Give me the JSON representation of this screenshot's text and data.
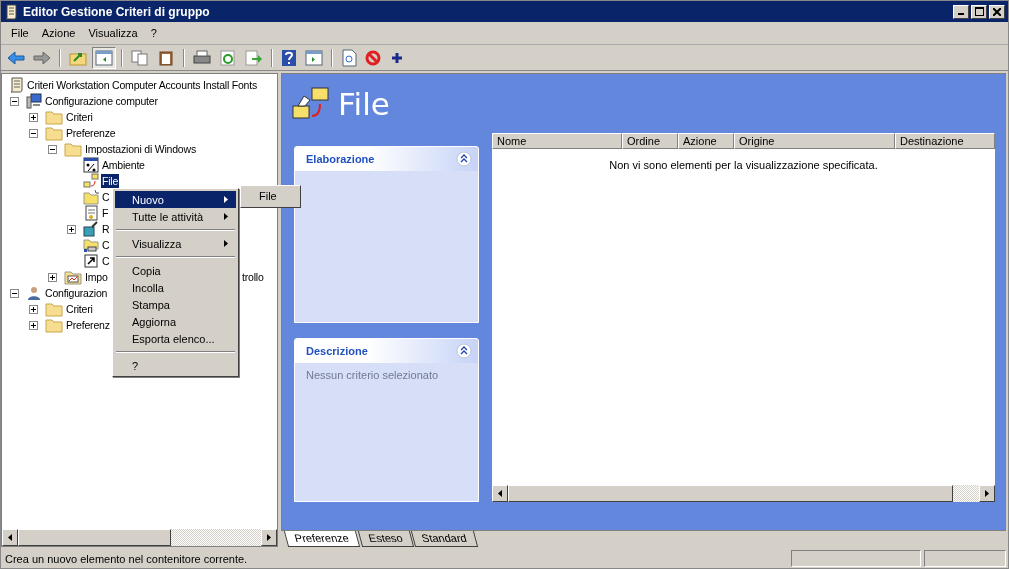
{
  "window": {
    "title": "Editor Gestione Criteri di gruppo"
  },
  "menu_bar": [
    "File",
    "Azione",
    "Visualizza",
    "?"
  ],
  "tree": [
    {
      "label": "Criteri Workstation Computer Accounts Install Fonts",
      "kind": "policy",
      "selected": false,
      "children": [
        {
          "label": "Configurazione computer",
          "kind": "computer",
          "expanded": true,
          "selected": false,
          "children": [
            {
              "label": "Criteri",
              "kind": "folder",
              "expanded": false,
              "selected": false
            },
            {
              "label": "Preferenze",
              "kind": "folder",
              "expanded": true,
              "selected": false,
              "children": [
                {
                  "label": "Impostazioni di Windows",
                  "kind": "folder",
                  "expanded": true,
                  "selected": false,
                  "children": [
                    {
                      "label": "Ambiente",
                      "kind": "env",
                      "selected": false
                    },
                    {
                      "label": "File",
                      "kind": "files",
                      "selected": true
                    },
                    {
                      "label": "C",
                      "kind": "newfolder",
                      "selected": false
                    },
                    {
                      "label": "F",
                      "kind": "ini",
                      "selected": false
                    },
                    {
                      "label": "R",
                      "kind": "registry",
                      "expanded": false,
                      "selected": false
                    },
                    {
                      "label": "C",
                      "kind": "drive",
                      "selected": false
                    },
                    {
                      "label": "C",
                      "kind": "shortcut",
                      "selected": false
                    }
                  ]
                },
                {
                  "label": "Impo",
                  "tail": "trollo",
                  "kind": "control",
                  "expanded": false,
                  "selected": false
                }
              ]
            }
          ]
        },
        {
          "label": "Configurazion",
          "kind": "user",
          "expanded": true,
          "selected": false,
          "children": [
            {
              "label": "Criteri",
              "kind": "folder",
              "expanded": false,
              "selected": false
            },
            {
              "label": "Preferenz",
              "kind": "folder",
              "expanded": false,
              "selected": false
            }
          ]
        }
      ]
    }
  ],
  "context_menu": [
    {
      "kind": "item",
      "label": "Nuovo",
      "submenu": true,
      "selected": true
    },
    {
      "kind": "item",
      "label": "Tutte le attività",
      "submenu": true,
      "selected": false
    },
    {
      "kind": "separator"
    },
    {
      "kind": "item",
      "label": "Visualizza",
      "submenu": true,
      "selected": false
    },
    {
      "kind": "separator"
    },
    {
      "kind": "item",
      "label": "Copia",
      "submenu": false,
      "selected": false
    },
    {
      "kind": "item",
      "label": "Incolla",
      "submenu": false,
      "selected": false
    },
    {
      "kind": "item",
      "label": "Stampa",
      "submenu": false,
      "selected": false
    },
    {
      "kind": "item",
      "label": "Aggiorna",
      "submenu": false,
      "selected": false
    },
    {
      "kind": "item",
      "label": "Esporta elenco...",
      "submenu": false,
      "selected": false
    },
    {
      "kind": "separator"
    },
    {
      "kind": "item",
      "label": "?",
      "submenu": false,
      "selected": false
    }
  ],
  "submenu": [
    {
      "label": "File"
    }
  ],
  "header": {
    "title": "File"
  },
  "panels": [
    {
      "title": "Elaborazione"
    },
    {
      "title": "Descrizione",
      "text": "Nessun criterio selezionato"
    }
  ],
  "list": {
    "columns": [
      "Nome",
      "Ordine",
      "Azione",
      "Origine",
      "Destinazione"
    ],
    "empty_message": "Non vi sono elementi per la visualizzazione specificata."
  },
  "tabs": [
    {
      "label": "Preferenze",
      "selected": true
    },
    {
      "label": "Esteso",
      "selected": false
    },
    {
      "label": "Standard",
      "selected": false
    }
  ],
  "status_bar": {
    "text": "Crea un nuovo elemento nel contenitore corrente."
  }
}
